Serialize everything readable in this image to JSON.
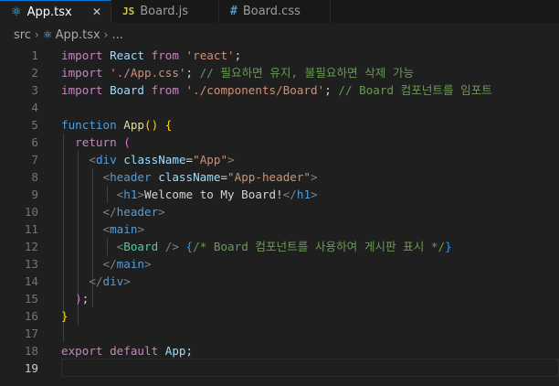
{
  "tabs": [
    {
      "label": "App.tsx",
      "icon": "react-icon",
      "active": true,
      "close": "✕"
    },
    {
      "label": "Board.js",
      "icon": "js-icon",
      "icon_text": "JS"
    },
    {
      "label": "Board.css",
      "icon": "css-icon",
      "icon_text": "#"
    }
  ],
  "breadcrumb": {
    "folder": "src",
    "file": "App.tsx",
    "more": "..."
  },
  "lines": [
    {
      "n": "1",
      "tokens": [
        [
          "kw",
          "import"
        ],
        [
          "txt",
          " "
        ],
        [
          "id",
          "React"
        ],
        [
          "txt",
          " "
        ],
        [
          "kw",
          "from"
        ],
        [
          "txt",
          " "
        ],
        [
          "str",
          "'react'"
        ],
        [
          "txt",
          ";"
        ]
      ]
    },
    {
      "n": "2",
      "tokens": [
        [
          "kw",
          "import"
        ],
        [
          "txt",
          " "
        ],
        [
          "str",
          "'./App.css'"
        ],
        [
          "txt",
          "; "
        ],
        [
          "cm",
          "// 필요하면 유지, 불필요하면 삭제 가능"
        ]
      ]
    },
    {
      "n": "3",
      "tokens": [
        [
          "kw",
          "import"
        ],
        [
          "txt",
          " "
        ],
        [
          "id",
          "Board"
        ],
        [
          "txt",
          " "
        ],
        [
          "kw",
          "from"
        ],
        [
          "txt",
          " "
        ],
        [
          "str",
          "'./components/Board'"
        ],
        [
          "txt",
          "; "
        ],
        [
          "cm",
          "// Board 컴포넌트를 임포트"
        ]
      ]
    },
    {
      "n": "4",
      "tokens": []
    },
    {
      "n": "5",
      "tokens": [
        [
          "kb",
          "function"
        ],
        [
          "txt",
          " "
        ],
        [
          "fn",
          "App"
        ],
        [
          "br",
          "()"
        ],
        [
          "txt",
          " "
        ],
        [
          "br",
          "{"
        ]
      ]
    },
    {
      "n": "6",
      "tokens": [
        [
          "txt",
          "  "
        ],
        [
          "kw",
          "return"
        ],
        [
          "txt",
          " "
        ],
        [
          "br2",
          "("
        ]
      ]
    },
    {
      "n": "7",
      "tokens": [
        [
          "txt",
          "    "
        ],
        [
          "gr",
          "<"
        ],
        [
          "tg",
          "div"
        ],
        [
          "txt",
          " "
        ],
        [
          "at",
          "className"
        ],
        [
          "txt",
          "="
        ],
        [
          "str",
          "\"App\""
        ],
        [
          "gr",
          ">"
        ]
      ]
    },
    {
      "n": "8",
      "tokens": [
        [
          "txt",
          "      "
        ],
        [
          "gr",
          "<"
        ],
        [
          "tg",
          "header"
        ],
        [
          "txt",
          " "
        ],
        [
          "at",
          "className"
        ],
        [
          "txt",
          "="
        ],
        [
          "str",
          "\"App-header\""
        ],
        [
          "gr",
          ">"
        ]
      ]
    },
    {
      "n": "9",
      "tokens": [
        [
          "txt",
          "        "
        ],
        [
          "gr",
          "<"
        ],
        [
          "tg",
          "h1"
        ],
        [
          "gr",
          ">"
        ],
        [
          "txt",
          "Welcome to My Board!"
        ],
        [
          "gr",
          "</"
        ],
        [
          "tg",
          "h1"
        ],
        [
          "gr",
          ">"
        ]
      ]
    },
    {
      "n": "10",
      "tokens": [
        [
          "txt",
          "      "
        ],
        [
          "gr",
          "</"
        ],
        [
          "tg",
          "header"
        ],
        [
          "gr",
          ">"
        ]
      ]
    },
    {
      "n": "11",
      "tokens": [
        [
          "txt",
          "      "
        ],
        [
          "gr",
          "<"
        ],
        [
          "tg",
          "main"
        ],
        [
          "gr",
          ">"
        ]
      ]
    },
    {
      "n": "12",
      "tokens": [
        [
          "txt",
          "        "
        ],
        [
          "gr",
          "<"
        ],
        [
          "cls",
          "Board"
        ],
        [
          "txt",
          " "
        ],
        [
          "gr",
          "/>"
        ],
        [
          "txt",
          " "
        ],
        [
          "br3",
          "{"
        ],
        [
          "cm",
          "/* Board 컴포넌트를 사용하여 게시판 표시 */"
        ],
        [
          "br3",
          "}"
        ]
      ]
    },
    {
      "n": "13",
      "tokens": [
        [
          "txt",
          "      "
        ],
        [
          "gr",
          "</"
        ],
        [
          "tg",
          "main"
        ],
        [
          "gr",
          ">"
        ]
      ]
    },
    {
      "n": "14",
      "tokens": [
        [
          "txt",
          "    "
        ],
        [
          "gr",
          "</"
        ],
        [
          "tg",
          "div"
        ],
        [
          "gr",
          ">"
        ]
      ]
    },
    {
      "n": "15",
      "tokens": [
        [
          "txt",
          "  "
        ],
        [
          "br2",
          ")"
        ],
        [
          "txt",
          ";"
        ]
      ]
    },
    {
      "n": "16",
      "tokens": [
        [
          "br",
          "}"
        ]
      ]
    },
    {
      "n": "17",
      "tokens": []
    },
    {
      "n": "18",
      "tokens": [
        [
          "kw",
          "export"
        ],
        [
          "txt",
          " "
        ],
        [
          "kw",
          "default"
        ],
        [
          "txt",
          " "
        ],
        [
          "id",
          "App"
        ],
        [
          "txt",
          ";"
        ]
      ]
    },
    {
      "n": "19",
      "tokens": [],
      "current": true
    }
  ],
  "colors": {
    "accent": "#0078d4",
    "background": "#1f1f1f"
  }
}
